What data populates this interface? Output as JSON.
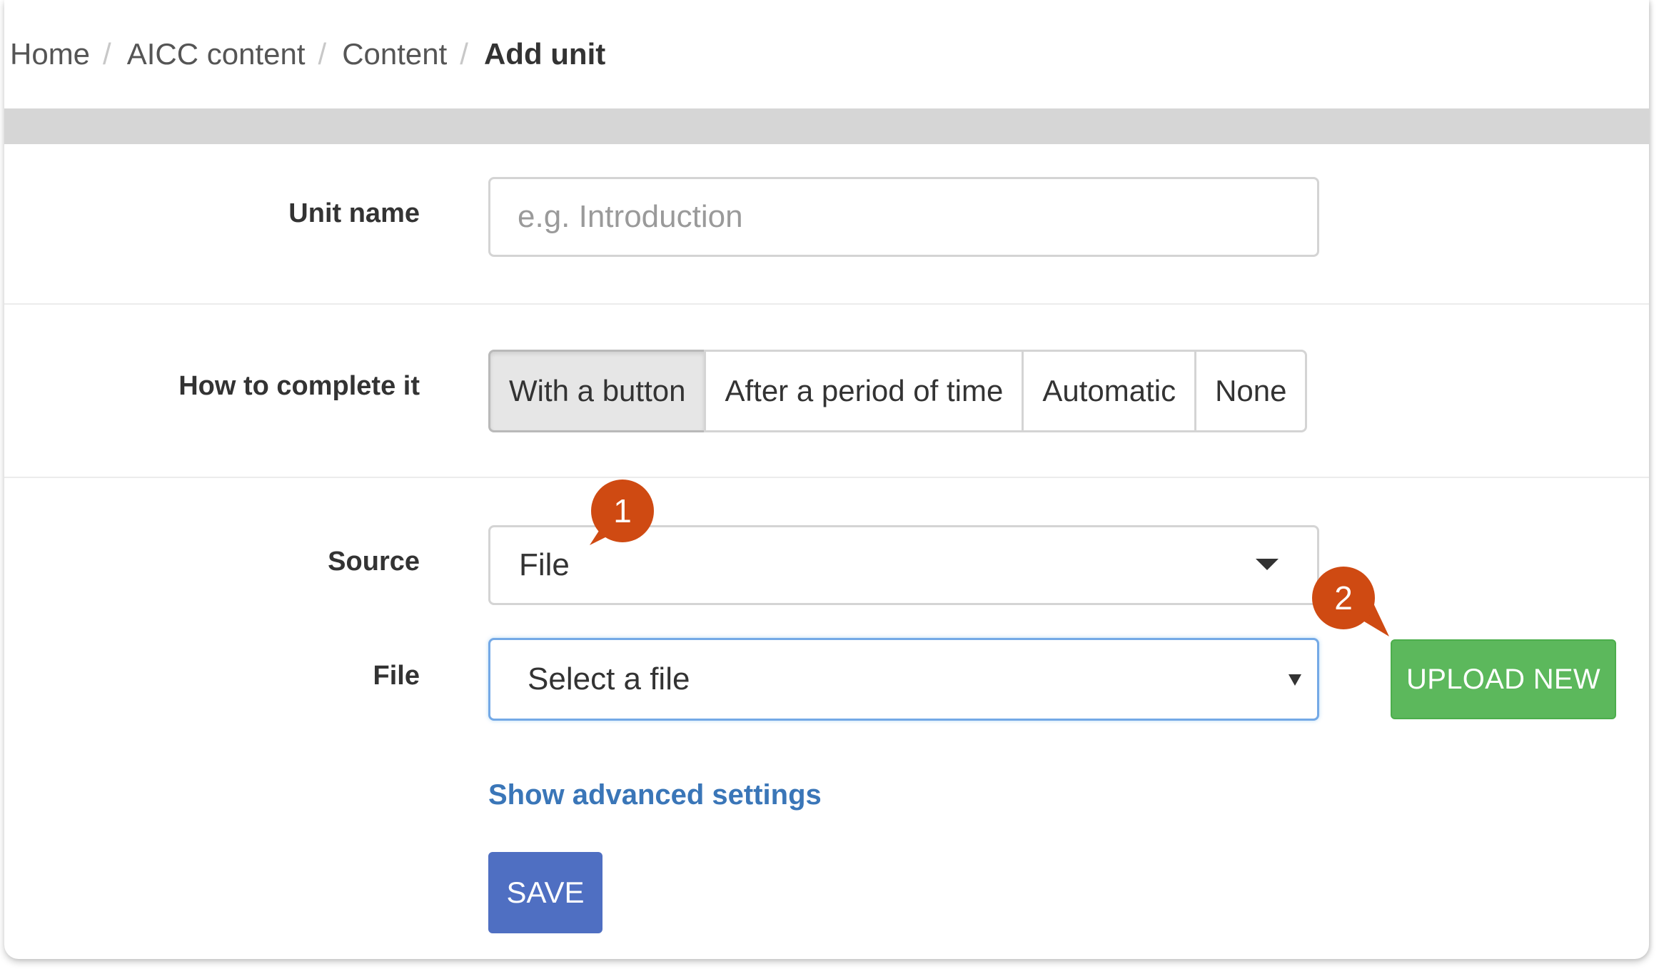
{
  "breadcrumb": {
    "items": [
      "Home",
      "AICC content",
      "Content"
    ],
    "separator": "/",
    "current": "Add unit"
  },
  "form": {
    "unit_name": {
      "label": "Unit name",
      "placeholder": "e.g. Introduction",
      "value": ""
    },
    "completion": {
      "label": "How to complete it",
      "options": [
        "With a button",
        "After a period of time",
        "Automatic",
        "None"
      ],
      "selected": "With a button"
    },
    "source": {
      "label": "Source",
      "value": "File"
    },
    "file": {
      "label": "File",
      "value": "Select a file"
    },
    "upload_button": "UPLOAD NEW",
    "advanced_link": "Show advanced settings",
    "save_button": "SAVE"
  },
  "annotations": {
    "marker_1": "1",
    "marker_2": "2",
    "marker_color": "#cf4a12"
  },
  "colors": {
    "upload_green": "#5cb85c",
    "save_blue": "#4f6fc2",
    "link_blue": "#3a76b8",
    "focus_border": "#74a9e6",
    "header_bar": "#d6d6d6"
  }
}
